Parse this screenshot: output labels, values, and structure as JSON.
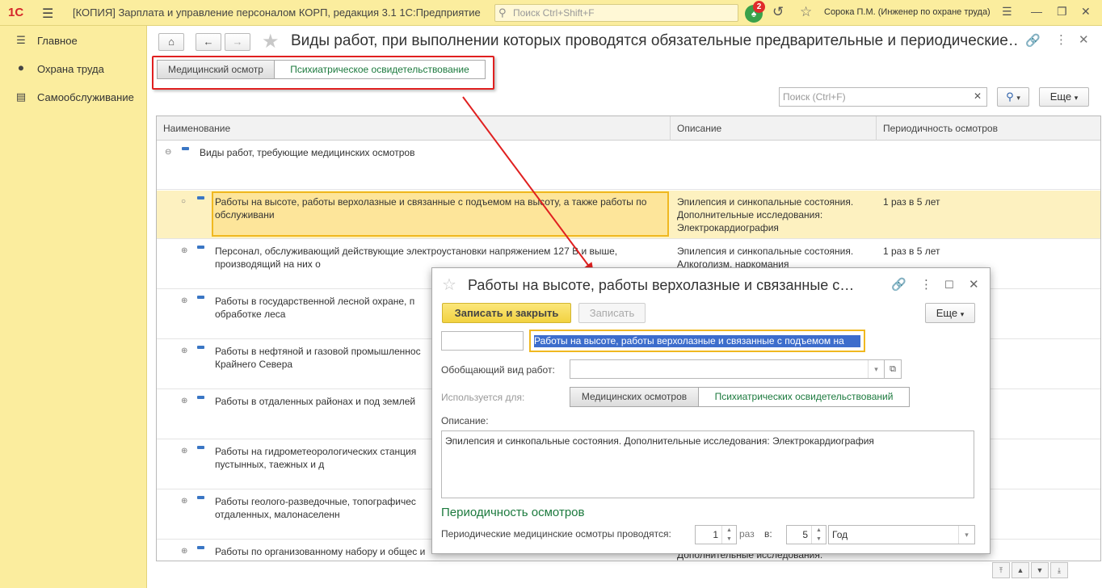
{
  "app": {
    "logo": "1С",
    "title": "[КОПИЯ] Зарплата и управление персоналом КОРП, редакция 3.1 1С:Предприятие",
    "search_placeholder": "Поиск Ctrl+Shift+F",
    "notifications_count": "2",
    "user": "Сорока П.М. (Инженер по охране труда)"
  },
  "sidebar": {
    "items": [
      {
        "label": "Главное",
        "icon": "menu-lines-icon"
      },
      {
        "label": "Охрана труда",
        "icon": "helmet-icon"
      },
      {
        "label": "Самообслуживание",
        "icon": "id-card-icon"
      }
    ]
  },
  "form": {
    "title": "Виды работ, при выполнении которых проводятся обязательные предварительные и периодические…",
    "tabs": [
      "Медицинский осмотр",
      "Психиатрическое освидетельствование"
    ],
    "search_placeholder": "Поиск (Ctrl+F)",
    "more_label": "Еще",
    "columns": [
      "Наименование",
      "Описание",
      "Периодичность осмотров"
    ],
    "group_row": "Виды работ, требующие медицинских осмотров",
    "rows": [
      {
        "name": "Работы на высоте, работы верхолазные и связанные с подъемом на высоту, а также работы по обслуживани",
        "desc": "Эпилепсия и синкопальные состояния. Дополнительные исследования: Электрокардиография",
        "period": "1 раз в 5 лет"
      },
      {
        "name": "Персонал, обслуживающий действующие электроустановки напряжением 127 В и выше, производящий на них о",
        "desc": "Эпилепсия и синкопальные состояния. Алкоголизм, наркомания",
        "period": "1 раз в 5 лет"
      },
      {
        "name": "Работы в государственной лесной охране, п обработке леса",
        "desc": "",
        "period": ""
      },
      {
        "name": "Работы в нефтяной и газовой промышленнос Крайнего Севера",
        "desc": "",
        "period": ""
      },
      {
        "name": "Работы в отдаленных районах и под землей",
        "desc": "",
        "period": ""
      },
      {
        "name": "Работы на гидрометеорологических станция пустынных, таежных и д",
        "desc": "",
        "period": ""
      },
      {
        "name": "Работы геолого-разведочные, топографичес отдаленных, малонаселенн",
        "desc": "",
        "period": ""
      },
      {
        "name": "Работы по организованному набору и общес и приравненных к",
        "desc": "Дополнительные исследования:",
        "period": ""
      }
    ]
  },
  "dialog": {
    "title": "Работы на высоте, работы верхолазные и связанные с…",
    "save_close": "Записать и закрыть",
    "save": "Записать",
    "more": "Еще",
    "name_value": "Работы на высоте, работы верхолазные и связанные с подъемом на",
    "parent_label": "Обобщающий вид работ:",
    "used_for_label": "Используется для:",
    "used_for_options": [
      "Медицинских осмотров",
      "Психиатрических освидетельствований"
    ],
    "description_label": "Описание:",
    "description_value": "Эпилепсия и синкопальные состояния. Дополнительные исследования: Электрокардиография",
    "periodicity_header": "Периодичность осмотров",
    "periodic_label": "Периодические медицинские осмотры проводятся:",
    "times_value": "1",
    "times_label": "раз",
    "in_label": "в:",
    "period_value": "5",
    "unit_value": "Год"
  },
  "colors": {
    "accent_yellow": "#fbed9e",
    "highlight_red": "#e02020",
    "green_text": "#1c7a3e",
    "selection_blue": "#3d6dcc"
  }
}
